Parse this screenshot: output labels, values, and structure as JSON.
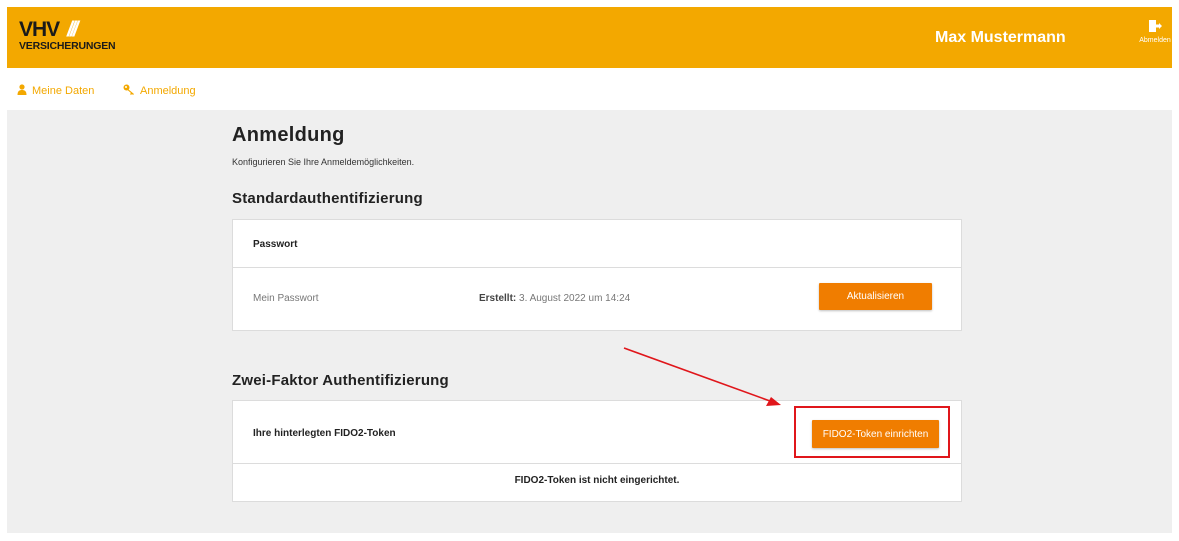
{
  "header": {
    "logo_main": "VHV",
    "logo_slashes": "///",
    "logo_sub": "VERSICHERUNGEN",
    "user_name": "Max Mustermann",
    "logout_label": "Abmelden",
    "logout_icon": "logout-icon",
    "brand_color": "#f3a800"
  },
  "subnav": {
    "items": [
      {
        "label": "Meine Daten",
        "icon": "user-icon"
      },
      {
        "label": "Anmeldung",
        "icon": "key-icon"
      }
    ]
  },
  "page": {
    "title": "Anmeldung",
    "subtitle": "Konfigurieren Sie Ihre Anmeldemöglichkeiten."
  },
  "standard_auth": {
    "section_title": "Standardauthentifizierung",
    "card_title": "Passwort",
    "item_name": "Mein Passwort",
    "created_label": "Erstellt:",
    "created_value": " 3. August 2022 um 14:24",
    "update_button": "Aktualisieren"
  },
  "two_factor": {
    "section_title": "Zwei-Faktor Authentifizierung",
    "card_title": "Ihre hinterlegten FIDO2-Token",
    "setup_button": "FIDO2-Token einrichten",
    "empty_message": "FIDO2-Token ist nicht eingerichtet."
  },
  "colors": {
    "accent": "#f3a800",
    "button": "#f07d00",
    "annotation": "#e0161b"
  }
}
